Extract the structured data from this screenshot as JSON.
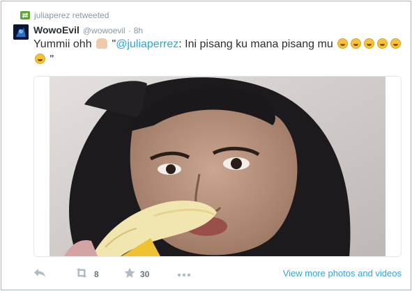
{
  "retweet": {
    "label": "juliaperez retweeted",
    "icon": "retweet-icon"
  },
  "author": {
    "name": "WowoEvil",
    "handle": "@wowoevil",
    "separator": "·",
    "time": "8h"
  },
  "tweet": {
    "text_before": "Yummii ohh",
    "quote_open": "\"",
    "mention": "@juliaperrez",
    "text_after": ": Ini pisang ku mana pisang mu",
    "quote_close": "\""
  },
  "actions": {
    "reply_icon": "reply-icon",
    "retweet_count": "8",
    "favorite_count": "30",
    "more_icon": "more-dots-icon",
    "view_more": "View more photos and videos"
  },
  "colors": {
    "link": "#2fa4d9",
    "retweet_green": "#5aa830",
    "muted": "#8899a6"
  }
}
